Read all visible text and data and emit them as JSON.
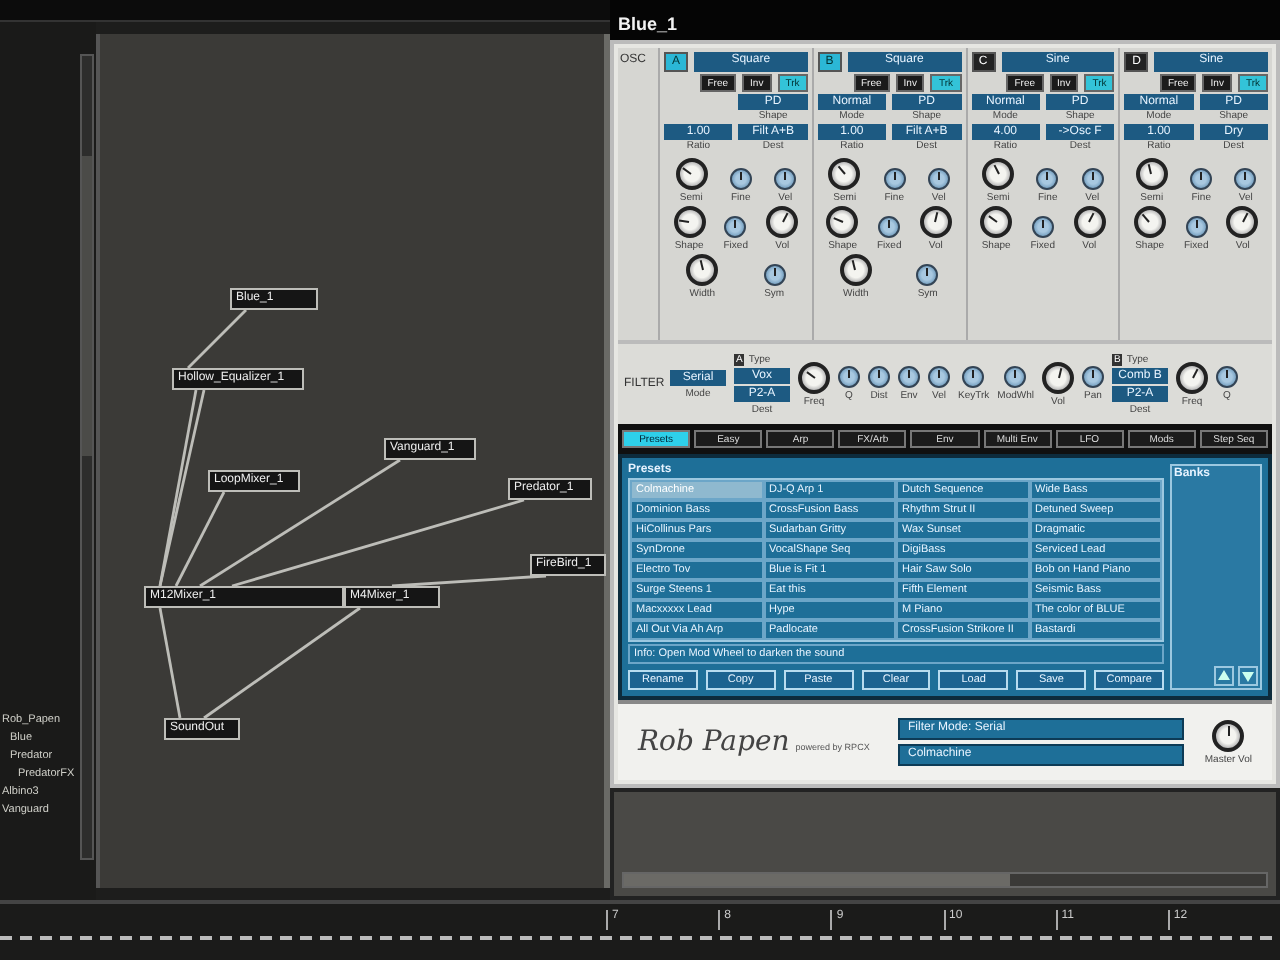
{
  "sidebar": {
    "items": [
      {
        "label": "Rob_Papen",
        "children": [
          {
            "label": "Blue"
          },
          {
            "label": "Predator",
            "children": [
              {
                "label": "PredatorFX"
              }
            ]
          }
        ]
      },
      {
        "label": "Albino3"
      },
      {
        "label": "Vanguard"
      }
    ]
  },
  "graph": {
    "nodes": [
      {
        "label": "Blue_1"
      },
      {
        "label": "Hollow_Equalizer_1"
      },
      {
        "label": "LoopMixer_1"
      },
      {
        "label": "Vanguard_1"
      },
      {
        "label": "Predator_1"
      },
      {
        "label": "FireBird_1"
      },
      {
        "label": "M12Mixer_1"
      },
      {
        "label": "M4Mixer_1"
      },
      {
        "label": "SoundOut"
      }
    ]
  },
  "window": {
    "title": "Blue_1"
  },
  "osc": {
    "title": "OSC",
    "oscillators": [
      {
        "letter": "A",
        "on": true,
        "wave": "Square",
        "buttons": [
          {
            "label": "Free",
            "on": false
          },
          {
            "label": "Inv",
            "on": false
          },
          {
            "label": "Trk",
            "on": true
          }
        ],
        "field_rows": [
          [
            {
              "value": "PD",
              "label": "Shape"
            }
          ],
          [
            {
              "value": "1.00",
              "label": "Ratio"
            },
            {
              "value": "Filt A+B",
              "label": "Dest"
            }
          ]
        ],
        "knob_rows": [
          [
            {
              "label": "Semi",
              "kind": "big",
              "level": 0.3
            },
            {
              "label": "Fine",
              "kind": "small",
              "level": 0.5
            },
            {
              "label": "Vel",
              "kind": "small",
              "level": 0.5
            }
          ],
          [
            {
              "label": "Shape",
              "kind": "big",
              "level": 0.2
            },
            {
              "label": "Fixed",
              "kind": "small",
              "level": 0.5
            },
            {
              "label": "Vol",
              "kind": "big",
              "level": 0.6
            }
          ],
          [
            {
              "label": "Width",
              "kind": "big",
              "level": 0.45
            },
            {
              "label": "Sym",
              "kind": "small",
              "level": 0.5
            }
          ]
        ]
      },
      {
        "letter": "B",
        "on": true,
        "wave": "Square",
        "buttons": [
          {
            "label": "Free",
            "on": false
          },
          {
            "label": "Inv",
            "on": false
          },
          {
            "label": "Trk",
            "on": true
          }
        ],
        "field_rows": [
          [
            {
              "value": "Normal",
              "label": "Mode"
            },
            {
              "value": "PD",
              "label": "Shape"
            }
          ],
          [
            {
              "value": "1.00",
              "label": "Ratio"
            },
            {
              "value": "Filt A+B",
              "label": "Dest"
            }
          ]
        ],
        "knob_rows": [
          [
            {
              "label": "Semi",
              "kind": "big",
              "level": 0.35
            },
            {
              "label": "Fine",
              "kind": "small",
              "level": 0.5
            },
            {
              "label": "Vel",
              "kind": "small",
              "level": 0.5
            }
          ],
          [
            {
              "label": "Shape",
              "kind": "big",
              "level": 0.25
            },
            {
              "label": "Fixed",
              "kind": "small",
              "level": 0.5
            },
            {
              "label": "Vol",
              "kind": "big",
              "level": 0.55
            }
          ],
          [
            {
              "label": "Width",
              "kind": "big",
              "level": 0.45
            },
            {
              "label": "Sym",
              "kind": "small",
              "level": 0.5
            }
          ]
        ]
      },
      {
        "letter": "C",
        "on": false,
        "wave": "Sine",
        "buttons": [
          {
            "label": "Free",
            "on": false
          },
          {
            "label": "Inv",
            "on": false
          },
          {
            "label": "Trk",
            "on": true
          }
        ],
        "field_rows": [
          [
            {
              "value": "Normal",
              "label": "Mode"
            },
            {
              "value": "PD",
              "label": "Shape"
            }
          ],
          [
            {
              "value": "4.00",
              "label": "Ratio"
            },
            {
              "value": "->Osc F",
              "label": "Dest"
            }
          ]
        ],
        "knob_rows": [
          [
            {
              "label": "Semi",
              "kind": "big",
              "level": 0.4
            },
            {
              "label": "Fine",
              "kind": "small",
              "level": 0.5
            },
            {
              "label": "Vel",
              "kind": "small",
              "level": 0.5
            }
          ],
          [
            {
              "label": "Shape",
              "kind": "big",
              "level": 0.3
            },
            {
              "label": "Fixed",
              "kind": "small",
              "level": 0.5
            },
            {
              "label": "Vol",
              "kind": "big",
              "level": 0.6
            }
          ]
        ]
      },
      {
        "letter": "D",
        "on": false,
        "wave": "Sine",
        "buttons": [
          {
            "label": "Free",
            "on": false
          },
          {
            "label": "Inv",
            "on": false
          },
          {
            "label": "Trk",
            "on": true
          }
        ],
        "field_rows": [
          [
            {
              "value": "Normal",
              "label": "Mode"
            },
            {
              "value": "PD",
              "label": "Shape"
            }
          ],
          [
            {
              "value": "1.00",
              "label": "Ratio"
            },
            {
              "value": "Dry",
              "label": "Dest"
            }
          ]
        ],
        "knob_rows": [
          [
            {
              "label": "Semi",
              "kind": "big",
              "level": 0.45
            },
            {
              "label": "Fine",
              "kind": "small",
              "level": 0.5
            },
            {
              "label": "Vel",
              "kind": "small",
              "level": 0.5
            }
          ],
          [
            {
              "label": "Shape",
              "kind": "big",
              "level": 0.35
            },
            {
              "label": "Fixed",
              "kind": "small",
              "level": 0.5
            },
            {
              "label": "Vol",
              "kind": "big",
              "level": 0.6
            }
          ]
        ]
      }
    ]
  },
  "filter": {
    "title": "FILTER",
    "mode": {
      "value": "Serial",
      "label": "Mode"
    },
    "sections": [
      {
        "letter": "A",
        "type_label": "Type",
        "values": [
          "Vox",
          "P2-A"
        ],
        "dest_label": "Dest",
        "knobs": [
          {
            "label": "Freq",
            "kind": "big",
            "level": 0.3
          },
          {
            "label": "Q",
            "kind": "small",
            "level": 0.5
          },
          {
            "label": "Dist",
            "kind": "small",
            "level": 0.5
          },
          {
            "label": "Env",
            "kind": "small",
            "level": 0.5
          },
          {
            "label": "Vel",
            "kind": "small",
            "level": 0.5
          },
          {
            "label": "KeyTrk",
            "kind": "small",
            "level": 0.5
          },
          {
            "label": "ModWhl",
            "kind": "small",
            "level": 0.5
          },
          {
            "label": "Vol",
            "kind": "big",
            "level": 0.55
          },
          {
            "label": "Pan",
            "kind": "small",
            "level": 0.5
          }
        ]
      },
      {
        "letter": "B",
        "type_label": "Type",
        "values": [
          "Comb B",
          "P2-A"
        ],
        "dest_label": "Dest",
        "knobs": [
          {
            "label": "Freq",
            "kind": "big",
            "level": 0.6
          },
          {
            "label": "Q",
            "kind": "small",
            "level": 0.5
          }
        ]
      }
    ]
  },
  "tabs": [
    {
      "label": "Presets",
      "selected": true
    },
    {
      "label": "Easy",
      "selected": false
    },
    {
      "label": "Arp",
      "selected": false
    },
    {
      "label": "FX/Arb",
      "selected": false
    },
    {
      "label": "Env",
      "selected": false
    },
    {
      "label": "Multi Env",
      "selected": false
    },
    {
      "label": "LFO",
      "selected": false
    },
    {
      "label": "Mods",
      "selected": false
    },
    {
      "label": "Step Seq",
      "selected": false
    }
  ],
  "presets": {
    "title": "Presets",
    "rows": [
      [
        {
          "name": "Colmachine",
          "selected": true
        },
        {
          "name": "DJ-Q Arp 1",
          "selected": false
        },
        {
          "name": "Dutch Sequence",
          "selected": false
        },
        {
          "name": "Wide Bass",
          "selected": false
        }
      ],
      [
        {
          "name": "Dominion Bass",
          "selected": false
        },
        {
          "name": "CrossFusion Bass",
          "selected": false
        },
        {
          "name": "Rhythm Strut II",
          "selected": false
        },
        {
          "name": "Detuned Sweep",
          "selected": false
        }
      ],
      [
        {
          "name": "HiCollinus Pars",
          "selected": false
        },
        {
          "name": "Sudarban Gritty",
          "selected": false
        },
        {
          "name": "Wax Sunset",
          "selected": false
        },
        {
          "name": "Dragmatic",
          "selected": false
        }
      ],
      [
        {
          "name": "SynDrone",
          "selected": false
        },
        {
          "name": "VocalShape Seq",
          "selected": false
        },
        {
          "name": "DigiBass",
          "selected": false
        },
        {
          "name": "Serviced Lead",
          "selected": false
        }
      ],
      [
        {
          "name": "Electro Tov",
          "selected": false
        },
        {
          "name": "Blue is Fit 1",
          "selected": false
        },
        {
          "name": "Hair Saw Solo",
          "selected": false
        },
        {
          "name": "Bob on Hand Piano",
          "selected": false
        }
      ],
      [
        {
          "name": "Surge Steens 1",
          "selected": false
        },
        {
          "name": "Eat this",
          "selected": false
        },
        {
          "name": "Fifth Element",
          "selected": false
        },
        {
          "name": "Seismic Bass",
          "selected": false
        }
      ],
      [
        {
          "name": "Macxxxxx Lead",
          "selected": false
        },
        {
          "name": "Hype",
          "selected": false
        },
        {
          "name": "M Piano",
          "selected": false
        },
        {
          "name": "The color of BLUE",
          "selected": false
        }
      ],
      [
        {
          "name": "All Out Via Ah Arp",
          "selected": false
        },
        {
          "name": "Padlocate",
          "selected": false
        },
        {
          "name": "CrossFusion Strikore II",
          "selected": false
        },
        {
          "name": "Bastardi",
          "selected": false
        }
      ]
    ],
    "info": "Info: Open Mod Wheel to darken the sound",
    "buttons": [
      "Rename",
      "Copy",
      "Paste",
      "Clear",
      "Load",
      "Save",
      "Compare"
    ]
  },
  "banks": {
    "title": "Banks"
  },
  "footer": {
    "logo": "Rob Papen",
    "powered": "powered by RPCX",
    "displays": [
      "Filter Mode: Serial",
      "Colmachine"
    ],
    "master": {
      "label": "Master Vol",
      "level": 0.5
    }
  },
  "timeline": {
    "labels": [
      "7",
      "8",
      "9",
      "10",
      "11",
      "12"
    ]
  }
}
